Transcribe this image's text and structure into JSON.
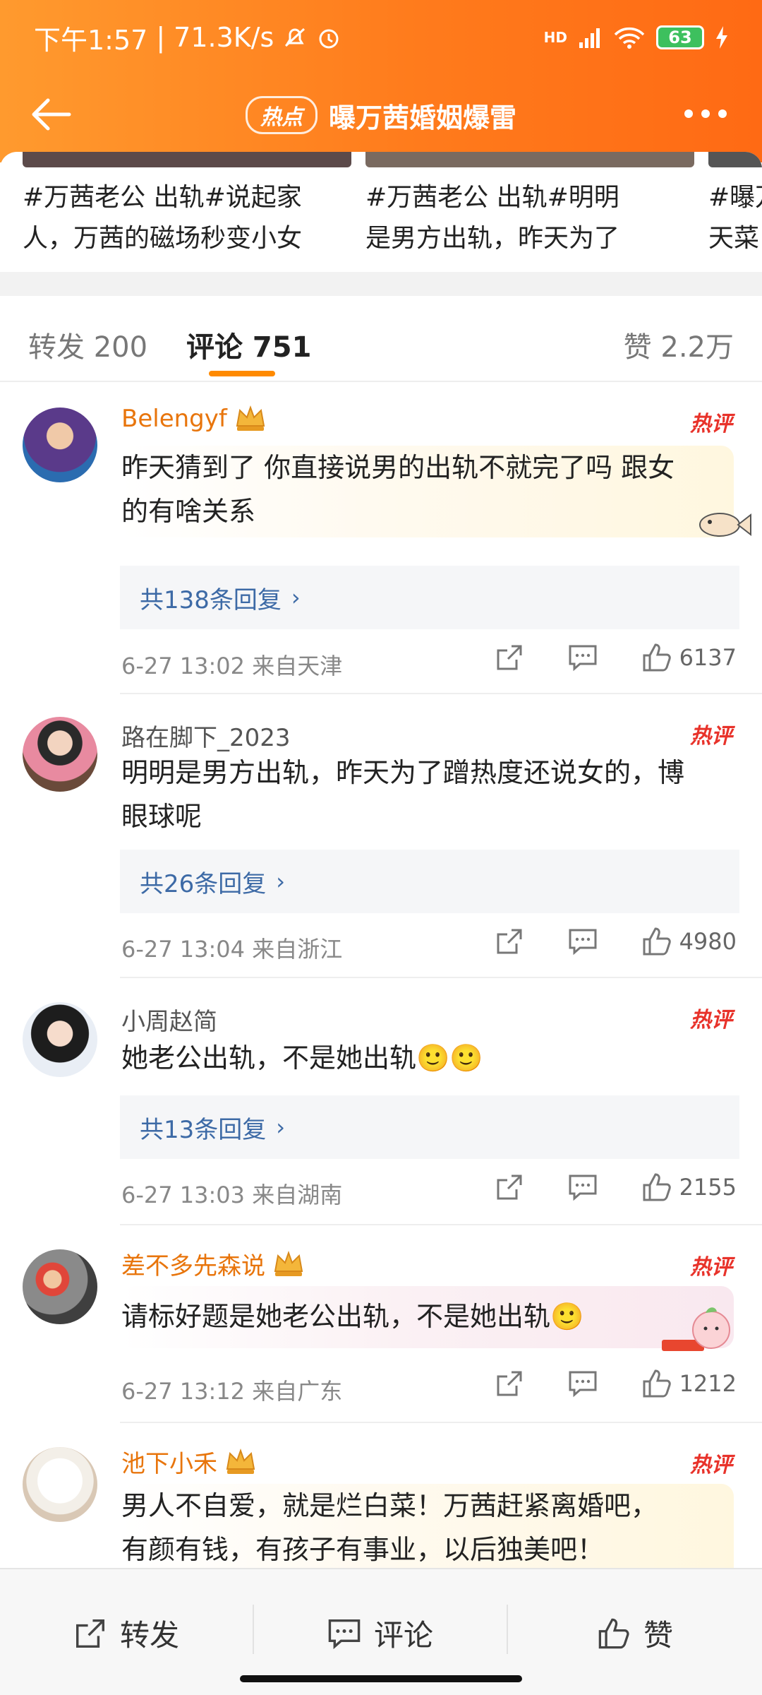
{
  "status_bar": {
    "time": "下午1:57",
    "speed": "71.3K/s",
    "network": "HD",
    "battery": "63"
  },
  "navbar": {
    "hot_label": "热点",
    "title": "曝万茜婚姻爆雷"
  },
  "related_cards": [
    {
      "line1": "#万茜老公 出轨#说起家",
      "line2": "人，万茜的磁场秒变小女"
    },
    {
      "line1": "#万茜老公 出轨#明明",
      "line2": "是男方出轨，昨天为了"
    },
    {
      "line1": "#曝万",
      "line2": "天菜"
    }
  ],
  "tabs": {
    "repost": "转发 200",
    "comments": "评论 751",
    "likes": "赞 2.2万"
  },
  "comments": [
    {
      "user": "Belengyf",
      "vip": true,
      "hot": "热评",
      "text_lines": [
        "昨天猜到了 你直接说男的出轨不就完了吗 跟女",
        "的有啥关系"
      ],
      "replies": "共138条回复",
      "time": "6-27 13:02",
      "location": "来自天津",
      "likes": "6137"
    },
    {
      "user": "路在脚下_2023",
      "vip": false,
      "hot": "热评",
      "text_lines": [
        "明明是男方出轨，昨天为了蹭热度还说女的，博",
        "眼球呢"
      ],
      "replies": "共26条回复",
      "time": "6-27 13:04",
      "location": "来自浙江",
      "likes": "4980"
    },
    {
      "user": "小周赵简",
      "vip": false,
      "hot": "热评",
      "text_lines": [
        "她老公出轨，不是她出轨🙂🙂"
      ],
      "replies": "共13条回复",
      "time": "6-27 13:03",
      "location": "来自湖南",
      "likes": "2155"
    },
    {
      "user": "差不多先森说",
      "vip": true,
      "hot": "热评",
      "text_lines": [
        "请标好题是她老公出轨，不是她出轨🙂"
      ],
      "time": "6-27 13:12",
      "location": "来自广东",
      "likes": "1212"
    },
    {
      "user": "池下小禾",
      "vip": true,
      "hot": "热评",
      "text_lines": [
        "男人不自爱，就是烂白菜！万茜赶紧离婚吧，",
        "有颜有钱，有孩子有事业，以后独美吧！"
      ]
    }
  ],
  "bottom_bar": {
    "repost": "转发",
    "comment": "评论",
    "like": "赞"
  },
  "colors": {
    "header_orange": "#ff7b1c",
    "vip_name": "#e8750c",
    "hot_tag": "#e8322a",
    "reply_link": "#3d6aa6",
    "tab_indicator": "#ff8a00"
  },
  "icons": [
    "back-arrow-icon",
    "more-icon",
    "crown-icon",
    "share-icon",
    "comment-icon",
    "like-icon"
  ]
}
